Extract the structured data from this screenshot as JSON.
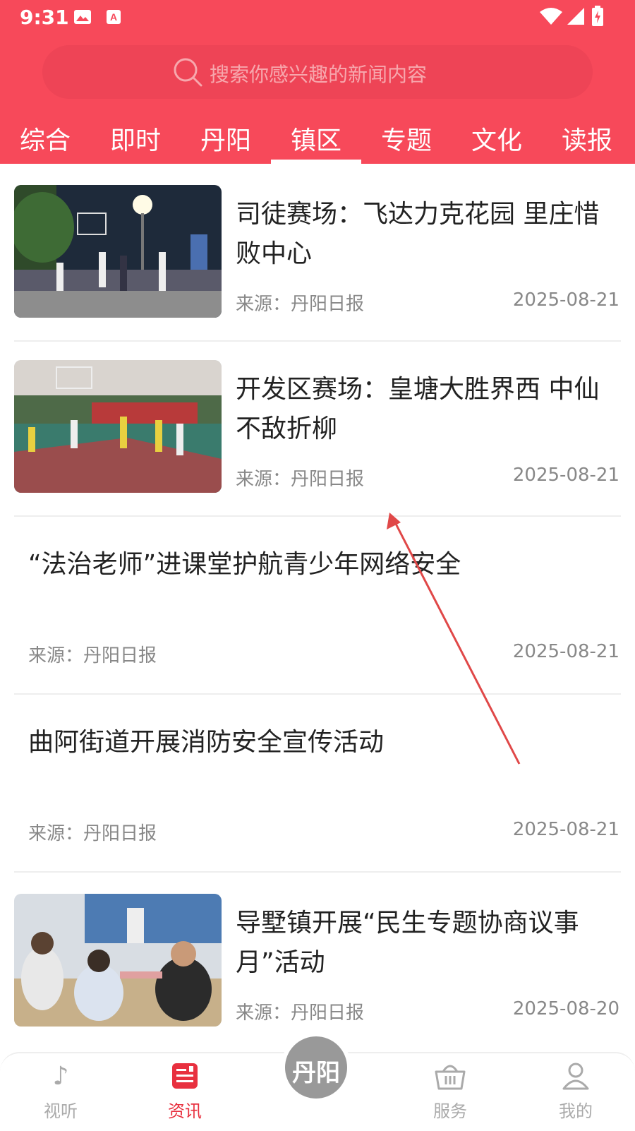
{
  "status_bar": {
    "time": "9:31"
  },
  "search": {
    "placeholder": "搜索你感兴趣的新闻内容"
  },
  "tabs": [
    {
      "label": "综合"
    },
    {
      "label": "即时"
    },
    {
      "label": "丹阳"
    },
    {
      "label": "镇区",
      "active": true
    },
    {
      "label": "专题"
    },
    {
      "label": "文化"
    },
    {
      "label": "读报"
    }
  ],
  "news": [
    {
      "title": "司徒赛场：飞达力克花园 里庄惜败中心",
      "source": "来源：丹阳日报",
      "date": "2025-08-21",
      "image": "basketball-night"
    },
    {
      "title": "开发区赛场：皇塘大胜界西 中仙不敌折柳",
      "source": "来源：丹阳日报",
      "date": "2025-08-21",
      "image": "basketball-court"
    },
    {
      "title": "“法治老师”进课堂护航青少年网络安全",
      "source": "来源：丹阳日报",
      "date": "2025-08-21"
    },
    {
      "title": "曲阿街道开展消防安全宣传活动",
      "source": "来源：丹阳日报",
      "date": "2025-08-21"
    },
    {
      "title": "导墅镇开展“民生专题协商议事月”活动",
      "source": "来源：丹阳日报",
      "date": "2025-08-20",
      "image": "meeting-room"
    }
  ],
  "bottom_nav": [
    {
      "label": "视听",
      "icon": "listen-icon"
    },
    {
      "label": "资讯",
      "icon": "news-icon",
      "active": true
    },
    {
      "label": "服务",
      "icon": "basket-icon"
    },
    {
      "label": "我的",
      "icon": "person-icon"
    }
  ],
  "center_logo": {
    "text": "丹阳"
  },
  "colors": {
    "brand": "#f7495a",
    "active_nav": "#e8303f",
    "inactive_nav": "#aaaaaa"
  }
}
